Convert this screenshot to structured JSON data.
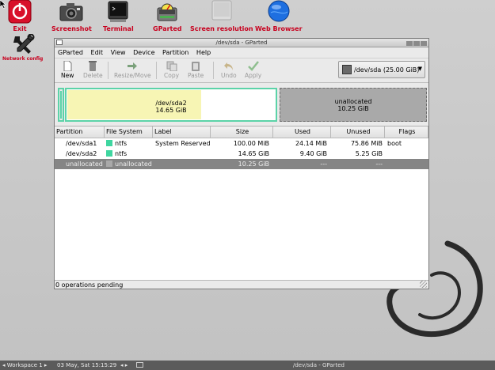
{
  "desktop": {
    "icons": [
      {
        "name": "exit",
        "label": "Exit"
      },
      {
        "name": "screenshot",
        "label": "Screenshot"
      },
      {
        "name": "terminal",
        "label": "Terminal"
      },
      {
        "name": "gparted",
        "label": "GParted"
      },
      {
        "name": "screen-resolution",
        "label": "Screen resolution"
      },
      {
        "name": "web-browser",
        "label": "Web Browser"
      },
      {
        "name": "network-config",
        "label": "Network config"
      }
    ]
  },
  "window": {
    "title": "/dev/sda - GParted",
    "menu": [
      "GParted",
      "Edit",
      "View",
      "Device",
      "Partition",
      "Help"
    ],
    "toolbar": {
      "new": "New",
      "delete": "Delete",
      "resize_move": "Resize/Move",
      "copy": "Copy",
      "paste": "Paste",
      "undo": "Undo",
      "apply": "Apply"
    },
    "device_selector": "/dev/sda  (25.00 GiB)",
    "graph": {
      "sda2_name": "/dev/sda2",
      "sda2_size": "14.65 GiB",
      "sda2_used_fraction": 0.64,
      "unallocated_name": "unallocated",
      "unallocated_size": "10.25 GiB"
    },
    "columns": [
      "Partition",
      "File System",
      "Label",
      "Size",
      "Used",
      "Unused",
      "Flags"
    ],
    "rows": [
      {
        "partition": "/dev/sda1",
        "fs": "ntfs",
        "label": "System Reserved",
        "size": "100.00 MiB",
        "used": "24.14 MiB",
        "unused": "75.86 MiB",
        "flags": "boot"
      },
      {
        "partition": "/dev/sda2",
        "fs": "ntfs",
        "label": "",
        "size": "14.65 GiB",
        "used": "9.40 GiB",
        "unused": "5.25 GiB",
        "flags": ""
      },
      {
        "partition": "unallocated",
        "fs": "unallocated",
        "label": "",
        "size": "10.25 GiB",
        "used": "---",
        "unused": "---",
        "flags": ""
      }
    ],
    "status": "0 operations pending"
  },
  "colors": {
    "ntfs": "#3fd6a0",
    "unallocated": "#a9a9a9",
    "label_red": "#c8001e"
  },
  "taskbar": {
    "workspace": "Workspace 1",
    "clock": "03 May, Sat 15:15:29",
    "active_task": "/dev/sda - GParted"
  }
}
